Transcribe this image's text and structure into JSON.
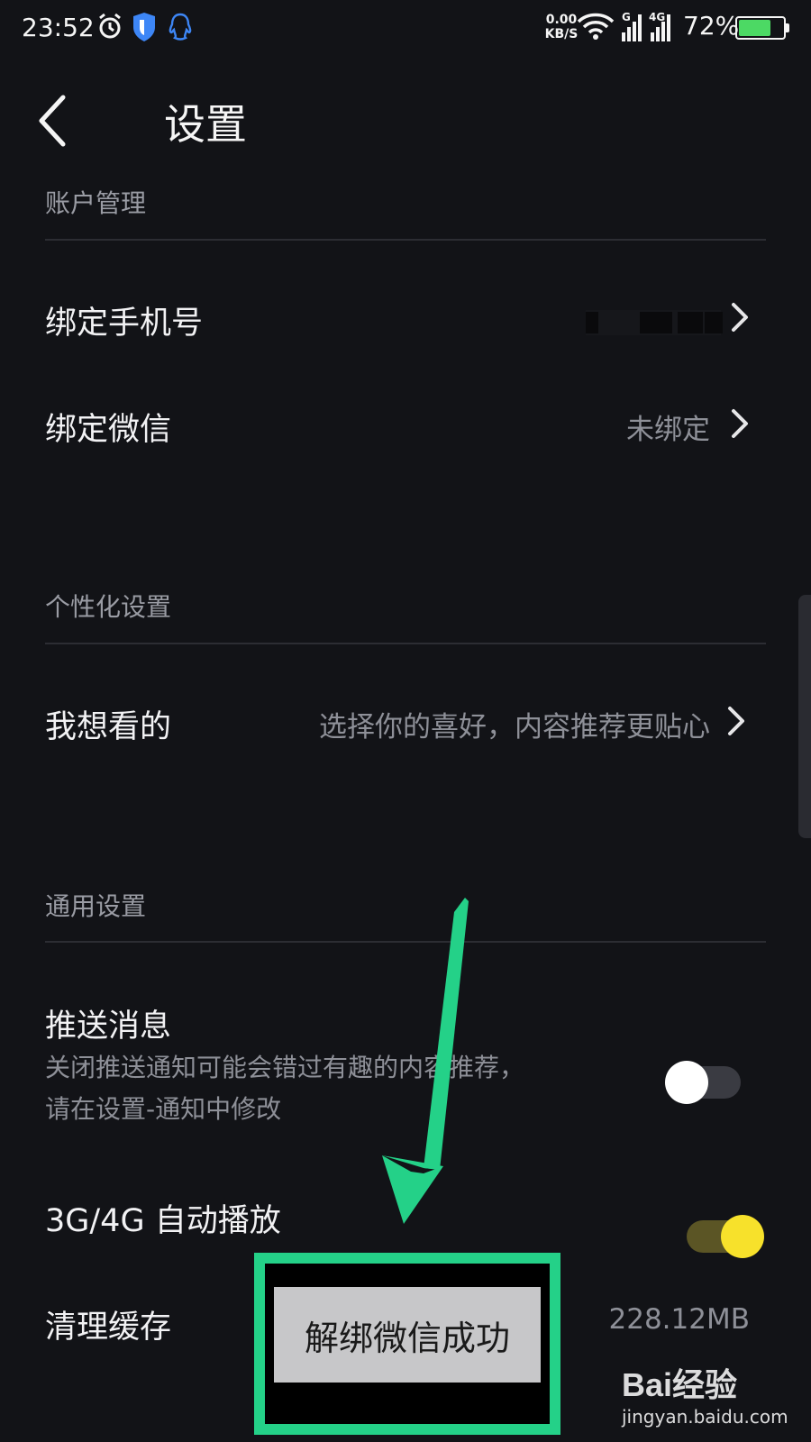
{
  "status_bar": {
    "time": "23:52",
    "net_speed_value": "0.00",
    "net_speed_unit": "KB/S",
    "signal1": "G",
    "signal2": "4G",
    "battery": "72%",
    "battery_level": 0.72,
    "battery_color": "#4cd964"
  },
  "header": {
    "title": "设置"
  },
  "account": {
    "section_title": "账户管理",
    "phone_label": "绑定手机号",
    "wechat_label": "绑定微信",
    "wechat_value": "未绑定"
  },
  "personal": {
    "section_title": "个性化设置",
    "preference_label": "我想看的",
    "preference_value": "选择你的喜好，内容推荐更贴心"
  },
  "general": {
    "section_title": "通用设置",
    "push_label": "推送消息",
    "push_desc_line1": "关闭推送通知可能会错过有趣的内容推荐，",
    "push_desc_line2": "请在设置-通知中修改",
    "push_enabled": false,
    "autoplay_label": "3G/4G 自动播放",
    "autoplay_enabled": true,
    "cache_label": "清理缓存",
    "cache_value": "228.12MB"
  },
  "toast": {
    "message": "解绑微信成功"
  },
  "watermark": {
    "brand": "Bai经验",
    "url": "jingyan.baidu.com"
  },
  "colors": {
    "background": "#121317",
    "annotation_green": "#24d188",
    "toggle_on": "#f7e12b"
  }
}
